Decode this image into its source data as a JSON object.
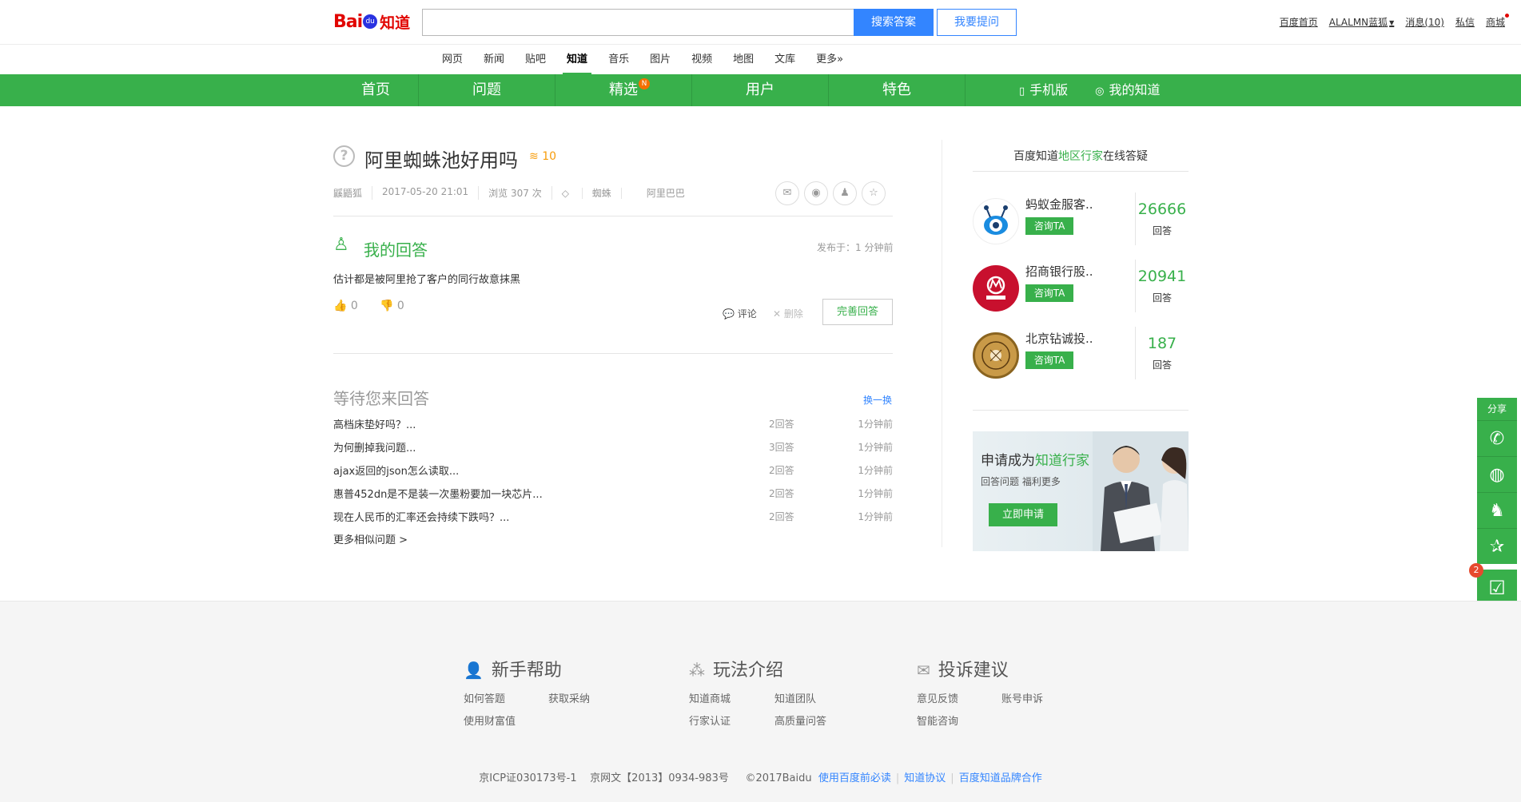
{
  "header": {
    "logo_text": "Bai",
    "logo_paw": "du",
    "logo_zhidao": "知道",
    "search_placeholder": "",
    "search_button": "搜索答案",
    "ask_button": "我要提问",
    "user_links": [
      "百度首页",
      "ALALMN蓝狐",
      "消息(10)",
      "私信",
      "商城"
    ]
  },
  "subnav": [
    "网页",
    "新闻",
    "贴吧",
    "知道",
    "音乐",
    "图片",
    "视频",
    "地图",
    "文库",
    "更多»"
  ],
  "subnav_active": "知道",
  "green_nav": {
    "items": [
      "首页",
      "问题",
      "精选",
      "用户",
      "特色"
    ],
    "badge": "N",
    "mobile": "手机版",
    "my_zhidao": "我的知道"
  },
  "question": {
    "title": "阿里蜘蛛池好用吗",
    "reward": "10",
    "author": "鼷鼯狐",
    "date": "2017-05-20 21:01",
    "views": "浏览 307 次",
    "tags": [
      "蜘蛛",
      "阿里巴巴"
    ]
  },
  "my_answer": {
    "heading": "我的回答",
    "published": "发布于：1 分钟前",
    "text": "估计都是被阿里抢了客户的同行故意抹黑",
    "likes": "0",
    "dislikes": "0",
    "comment": "评论",
    "delete": "删除",
    "improve": "完善回答"
  },
  "waiting": {
    "title": "等待您来回答",
    "swap": "换一换",
    "items": [
      {
        "q": "高档床垫好吗？...",
        "answers": "2回答",
        "time": "1分钟前"
      },
      {
        "q": "为何删掉我问题...",
        "answers": "3回答",
        "time": "1分钟前"
      },
      {
        "q": "ajax返回的json怎么读取...",
        "answers": "2回答",
        "time": "1分钟前"
      },
      {
        "q": "惠普452dn是不是装一次墨粉要加一块芯片...",
        "answers": "2回答",
        "time": "1分钟前"
      },
      {
        "q": "现在人民币的汇率还会持续下跌吗？...",
        "answers": "2回答",
        "time": "1分钟前"
      }
    ],
    "more": "更多相似问题 >"
  },
  "sidebar": {
    "title_pre": "百度知道",
    "title_hl": "地区行家",
    "title_post": "在线答疑",
    "experts": [
      {
        "name": "蚂蚁金服客..",
        "ask": "咨询TA",
        "count": "26666",
        "label": "回答",
        "color": "#1a8ce0"
      },
      {
        "name": "招商银行股..",
        "ask": "咨询TA",
        "count": "20941",
        "label": "回答",
        "color": "#c8102e"
      },
      {
        "name": "北京钻诚投..",
        "ask": "咨询TA",
        "count": "187",
        "label": "回答",
        "color": "#b8862a"
      }
    ],
    "promo_pre": "申请成为",
    "promo_hl": "知道行家",
    "promo_sub": "回答问题  福利更多",
    "promo_button": "立即申请"
  },
  "float_share": {
    "title": "分享",
    "task_count": "2"
  },
  "footer": {
    "cols": [
      {
        "title": "新手帮助",
        "links": [
          "如何答题",
          "获取采纳",
          "使用财富值"
        ]
      },
      {
        "title": "玩法介绍",
        "links": [
          "知道商城",
          "知道团队",
          "行家认证",
          "高质量问答"
        ]
      },
      {
        "title": "投诉建议",
        "links": [
          "意见反馈",
          "账号申诉",
          "智能咨询"
        ]
      }
    ],
    "icp": "京ICP证030173号-1",
    "wenwang": "京网文【2013】0934-983号",
    "copy": "©2017Baidu",
    "link1": "使用百度前必读",
    "link2": "知道协议",
    "link3": "百度知道品牌合作"
  },
  "colors": {
    "green": "#38b04b",
    "blue": "#3385ff",
    "red": "#e10602",
    "orange": "#f79c0b"
  }
}
